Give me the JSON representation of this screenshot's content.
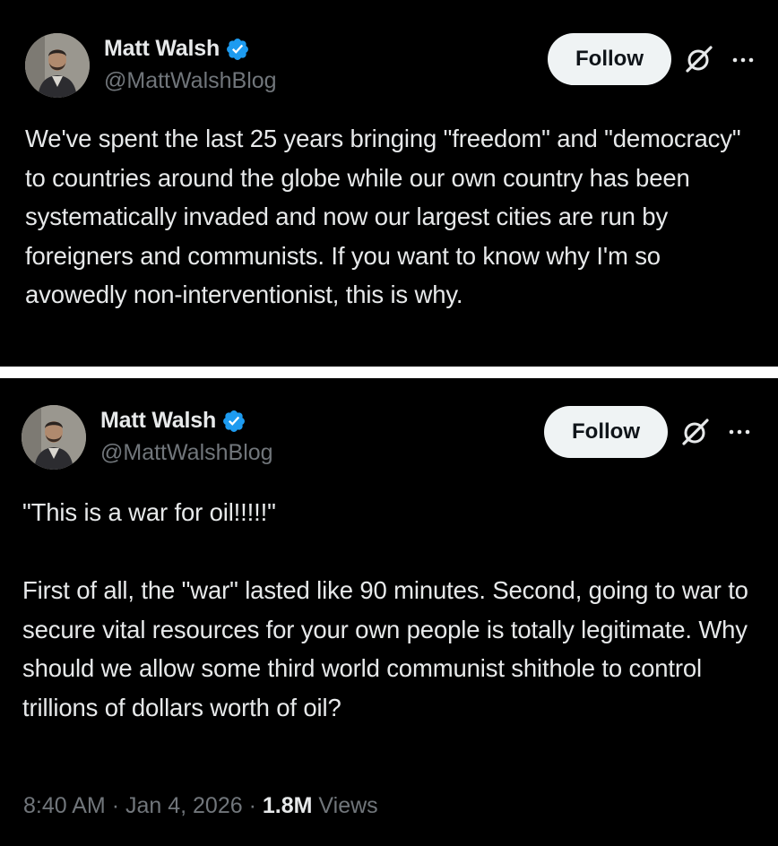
{
  "colors": {
    "background": "#000000",
    "text_primary": "#e7e9ea",
    "text_secondary": "#71767b",
    "verified_blue": "#1d9bf0",
    "follow_bg": "#eff3f4",
    "separator": "#ffffff"
  },
  "icons": [
    "verified-badge-icon",
    "grok-icon",
    "more-icon"
  ],
  "tweets": [
    {
      "author": {
        "display_name": "Matt Walsh",
        "handle": "@MattWalshBlog",
        "verified": true
      },
      "follow_label": "Follow",
      "text": "We've spent the last 25 years bringing \"freedom\" and \"democracy\" to countries around the globe while our own country has been systematically invaded and now our largest cities are run by foreigners and communists. If you want to know why I'm so avowedly non-interventionist, this is why."
    },
    {
      "author": {
        "display_name": "Matt Walsh",
        "handle": "@MattWalshBlog",
        "verified": true
      },
      "follow_label": "Follow",
      "text_paragraph_1": "\"This is a war for oil!!!!!\"",
      "text_paragraph_2": "First of all, the \"war\" lasted like 90 minutes. Second, going to war to secure vital resources for your own people is totally legitimate. Why should we allow some third world communist shithole to control trillions of dollars worth of oil?",
      "meta": {
        "time": "8:40 AM",
        "separator": "·",
        "date": "Jan 4, 2026",
        "views_count": "1.8M",
        "views_label": "Views"
      }
    }
  ]
}
